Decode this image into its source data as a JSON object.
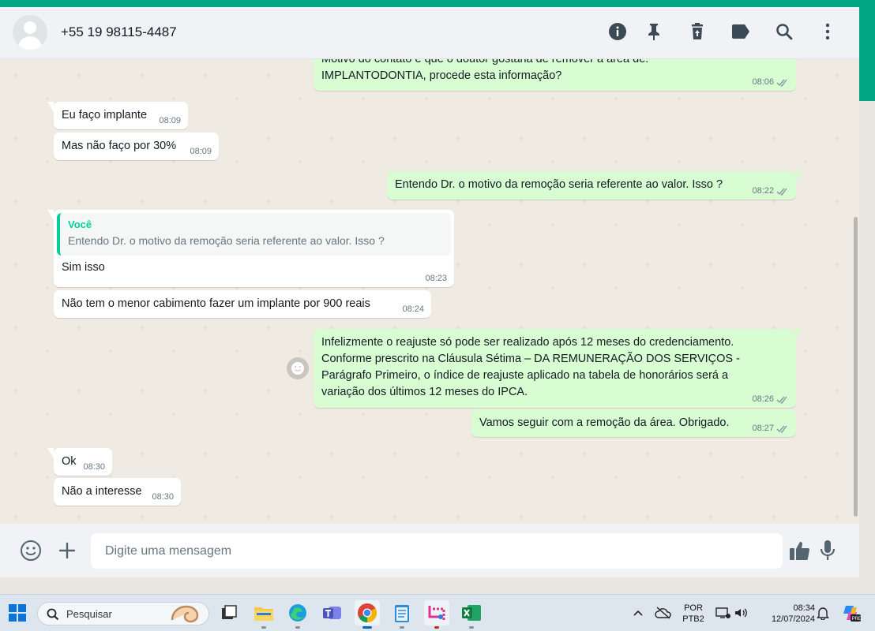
{
  "header": {
    "contact_name": "+55 19 98115-4487",
    "icons": [
      "info-icon",
      "pin-icon",
      "delete-icon",
      "label-icon",
      "search-icon",
      "menu-icon"
    ]
  },
  "messages": [
    {
      "dir": "out",
      "text_line1": "Motivo do contato e que o doutor gostaria de remover a área de:",
      "text_line2": "IMPLANTODONTIA, procede esta informação?",
      "time": "08:06"
    },
    {
      "dir": "in",
      "text": "Eu faço implante",
      "time": "08:09"
    },
    {
      "dir": "in",
      "text": "Mas não faço por 30%",
      "time": "08:09"
    },
    {
      "dir": "out",
      "text": "Entendo Dr. o motivo da remoção seria referente ao valor. Isso ?",
      "time": "08:22"
    },
    {
      "dir": "in",
      "quote_author": "Você",
      "quote_text": "Entendo Dr. o motivo da remoção seria referente ao valor. Isso ?",
      "text": "Sim isso",
      "time": "08:23"
    },
    {
      "dir": "in",
      "text": "Não tem o menor cabimento fazer um implante por 900 reais",
      "time": "08:24"
    },
    {
      "dir": "out",
      "lines": [
        "Infelizmente o reajuste só pode ser realizado após 12 meses do credenciamento.",
        "Conforme prescrito na Cláusula Sétima – DA REMUNERAÇÃO DOS SERVIÇOS -",
        "Parágrafo Primeiro, o índice de reajuste aplicado na tabela de honorários será a",
        "variação dos últimos 12 meses do IPCA."
      ],
      "time": "08:26"
    },
    {
      "dir": "out",
      "text": "Vamos seguir com a remoção da área. Obrigado.",
      "time": "08:27"
    },
    {
      "dir": "in",
      "text": "Ok",
      "time": "08:30"
    },
    {
      "dir": "in",
      "text": "Não a interesse",
      "time": "08:30"
    }
  ],
  "composer": {
    "placeholder": "Digite uma mensagem"
  },
  "taskbar": {
    "search_label": "Pesquisar",
    "lang_line1": "POR",
    "lang_line2": "PTB2",
    "time": "08:34",
    "date": "12/07/2024"
  },
  "colors": {
    "accent": "#00a884",
    "outgoing_bubble": "#d9fdd3",
    "incoming_bubble": "#ffffff",
    "quote_author": "#06cf9c",
    "read_ticks": "#8696a0"
  }
}
